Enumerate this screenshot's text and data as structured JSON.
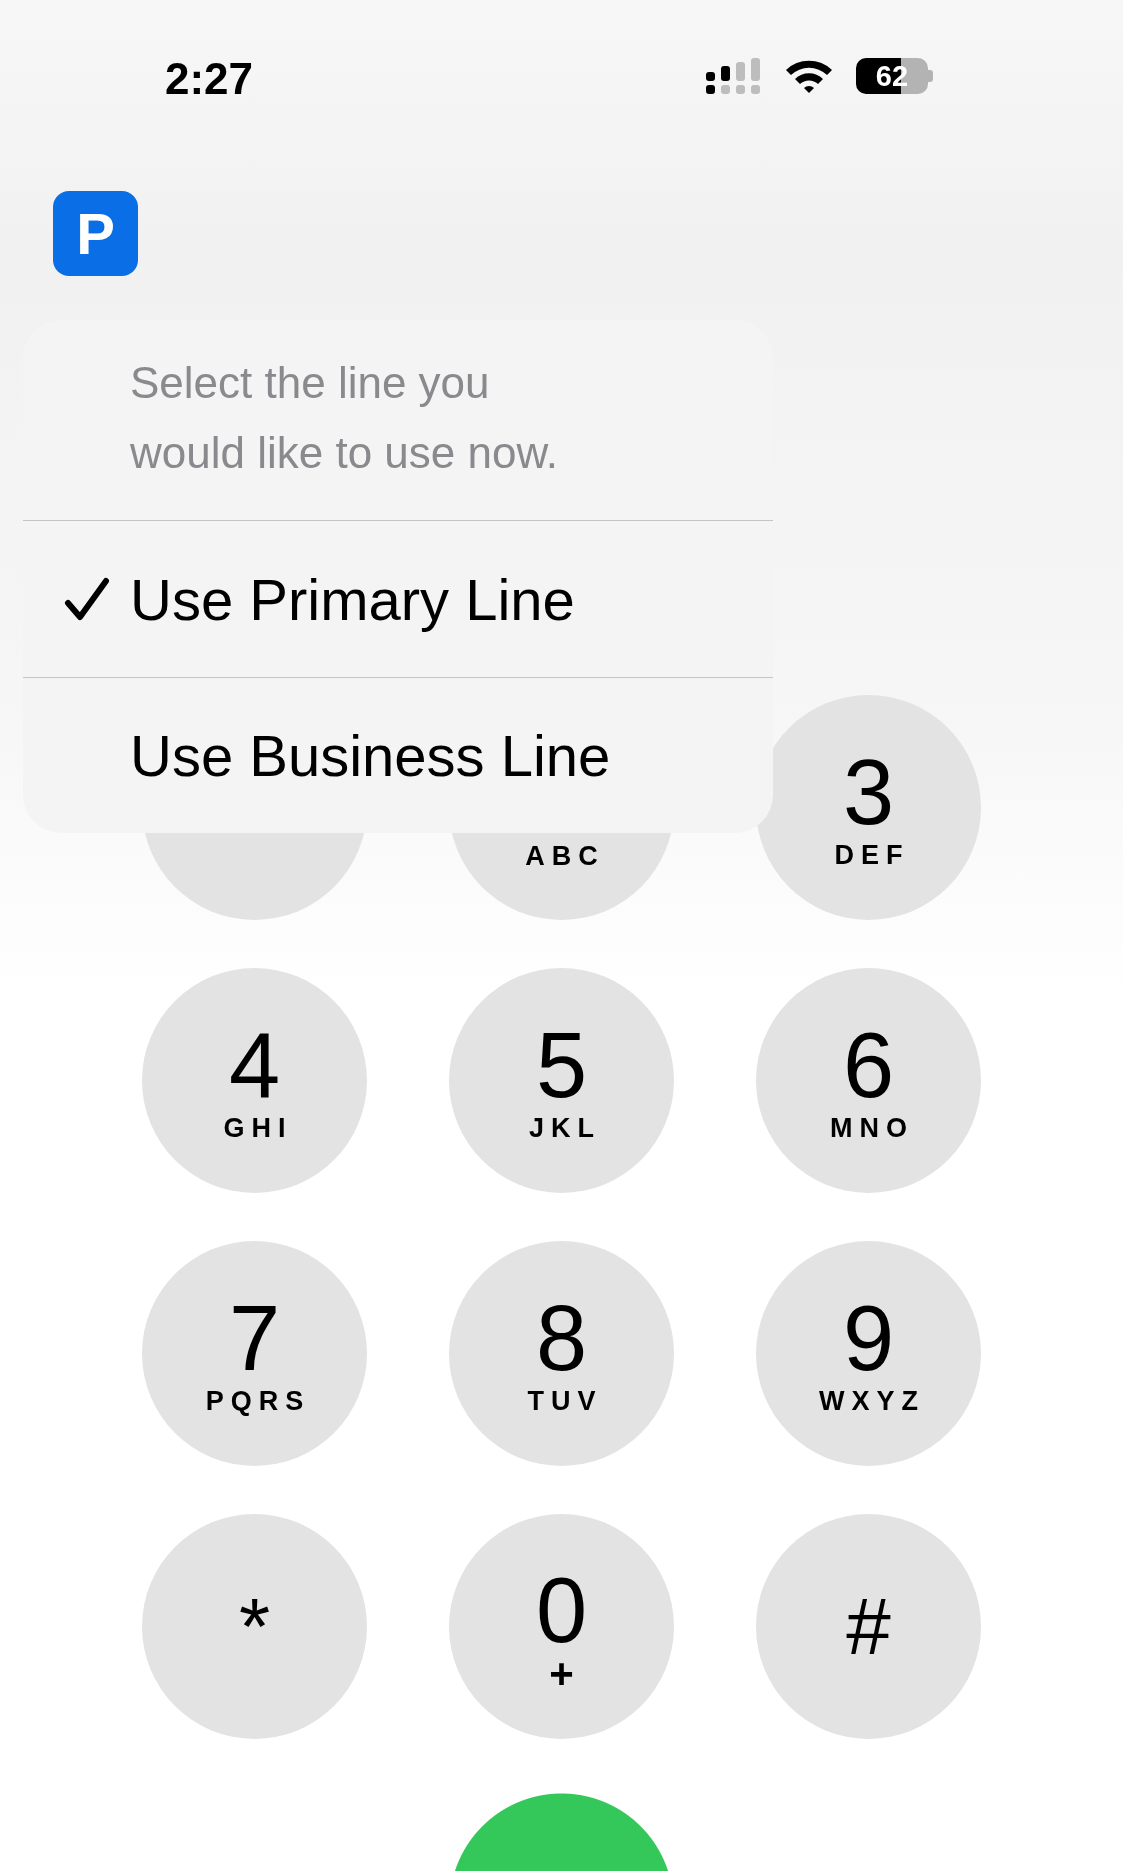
{
  "status_bar": {
    "time": "2:27",
    "battery": "62"
  },
  "app_badge": {
    "letter": "P"
  },
  "line_menu": {
    "prompt": "Select the line you would like to use now.",
    "items": [
      {
        "label": "Use Primary Line",
        "selected": true
      },
      {
        "label": "Use Business Line",
        "selected": false
      }
    ]
  },
  "keypad": [
    {
      "kind": "key"
    },
    {
      "kind": "key",
      "letters": "ABC"
    },
    {
      "kind": "key",
      "digit": "3",
      "letters": "DEF"
    },
    {
      "kind": "key",
      "digit": "4",
      "letters": "GHI"
    },
    {
      "kind": "key",
      "digit": "5",
      "letters": "JKL"
    },
    {
      "kind": "key",
      "digit": "6",
      "letters": "MNO"
    },
    {
      "kind": "key",
      "digit": "7",
      "letters": "PQRS"
    },
    {
      "kind": "key",
      "digit": "8",
      "letters": "TUV"
    },
    {
      "kind": "key",
      "digit": "9",
      "letters": "WXYZ"
    },
    {
      "kind": "key",
      "digit": "*"
    },
    {
      "kind": "key",
      "digit": "0",
      "letters": "+"
    },
    {
      "kind": "key",
      "digit": "#"
    }
  ],
  "call_button": {
    "kind": "call"
  }
}
